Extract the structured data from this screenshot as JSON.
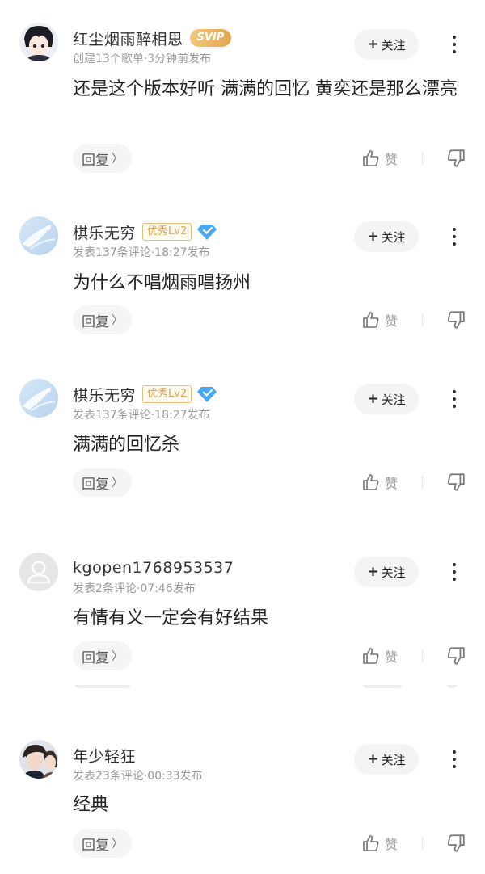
{
  "labels": {
    "follow": "关注",
    "reply": "回复",
    "like": "赞"
  },
  "comments": [
    {
      "username": "红尘烟雨醉相思",
      "badge": "SVIP",
      "meta": "创建13个歌单·3分钟前发布",
      "text": "还是这个版本好听 满满的回忆 黄奕还是那么漂亮"
    },
    {
      "username": "棋乐无穷",
      "badge": "优秀Lv2",
      "meta": "发表137条评论·18:27发布",
      "text": "为什么不唱烟雨唱扬州"
    },
    {
      "username": "棋乐无穷",
      "badge": "优秀Lv2",
      "meta": "发表137条评论·18:27发布",
      "text": "满满的回忆杀"
    },
    {
      "username": "kgopen1768953537",
      "badge": "",
      "meta": "发表2条评论·07:46发布",
      "text": "有情有义一定会有好结果"
    },
    {
      "username": "年少轻狂",
      "badge": "",
      "meta": "发表23条评论·00:33发布",
      "text": "经典"
    }
  ],
  "colors": {
    "svip_gold": "#e2a84d",
    "lv_gold": "#d9a54e",
    "diamond_blue": "#4aa8f0",
    "meta_gray": "#9a9a9a"
  },
  "icons": [
    "avatar",
    "svip-badge",
    "diamond-icon",
    "plus-icon",
    "more-icon",
    "chevron-right-icon",
    "thumb-up-icon",
    "thumb-down-icon"
  ]
}
